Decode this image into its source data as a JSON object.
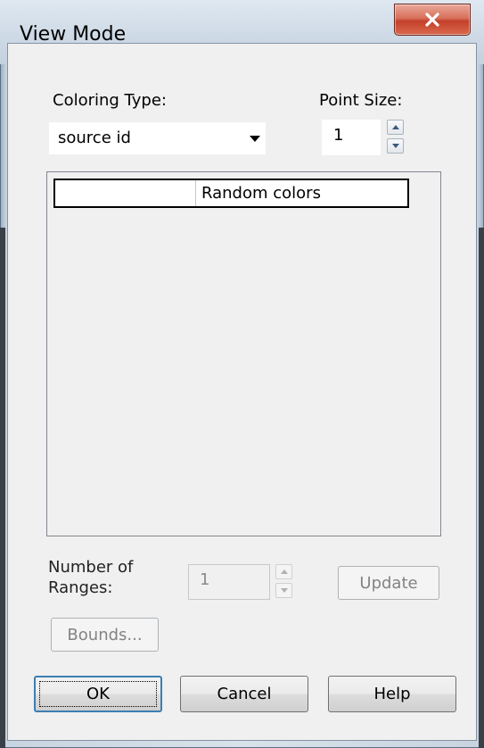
{
  "window": {
    "title": "View Mode",
    "close_icon": "close-icon"
  },
  "coloring": {
    "label": "Coloring Type:",
    "value": "source id",
    "dropdown_icon": "chevron-down-icon"
  },
  "point_size": {
    "label": "Point Size:",
    "value": "1"
  },
  "color_list": {
    "rows": [
      {
        "label": "Random colors"
      }
    ]
  },
  "ranges": {
    "label_line1": "Number of",
    "label_line2": "Ranges:",
    "value": "1",
    "enabled": false
  },
  "buttons": {
    "update": "Update",
    "bounds": "Bounds...",
    "ok": "OK",
    "cancel": "Cancel",
    "help": "Help"
  },
  "colors": {
    "close_button": "#c4402a",
    "default_button_border": "#3c7fb1",
    "dialog_background": "#f0f0f0"
  }
}
